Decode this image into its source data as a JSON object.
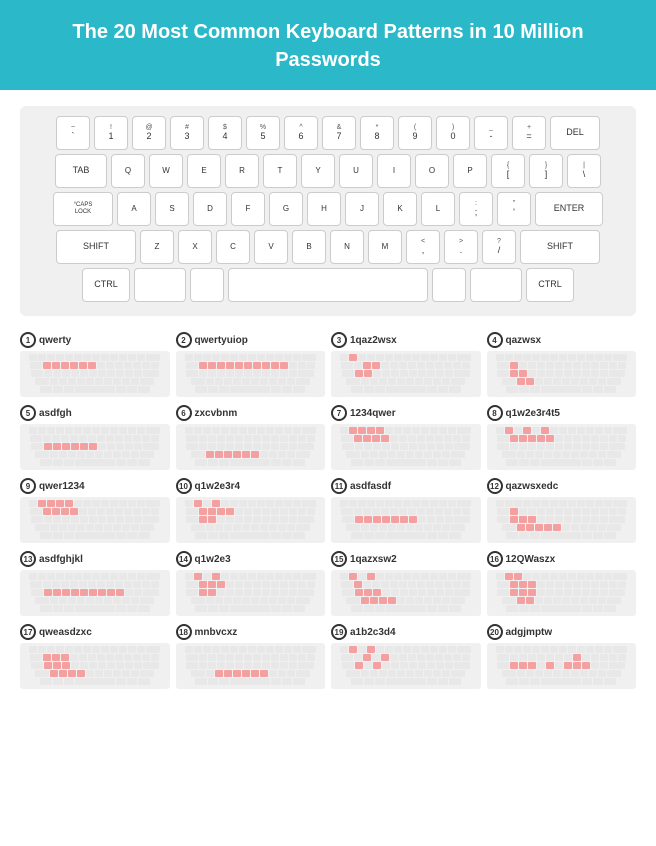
{
  "header": {
    "title": "The 20 Most Common Keyboard Patterns\nin 10 Million Passwords"
  },
  "patterns": {
    "p1": {
      "name": "qwerty"
    },
    "p2": {
      "name": "qwertyuiop"
    },
    "p3": {
      "name": "1qaz2wsx"
    },
    "p4": {
      "name": "qazwsx"
    },
    "p5": {
      "name": "asdfgh"
    },
    "p6": {
      "name": "zxcvbnm"
    },
    "p7": {
      "name": "1234qwer"
    },
    "p8": {
      "name": "q1w2e3r4t5"
    },
    "p9": {
      "name": "qwer1234"
    },
    "p10": {
      "name": "q1w2e3r4"
    },
    "p11": {
      "name": "asdfasdf"
    },
    "p12": {
      "name": "qazwsxedc"
    },
    "p13": {
      "name": "asdfghjkl"
    },
    "p14": {
      "name": "q1w2e3"
    },
    "p15": {
      "name": "1qazxsw2"
    },
    "p16": {
      "name": "12QWaszx"
    },
    "p17": {
      "name": "qweasdzxc"
    },
    "p18": {
      "name": "mnbvcxz"
    },
    "p19": {
      "name": "a1b2c3d4"
    },
    "p20": {
      "name": "adgjmptw"
    }
  }
}
